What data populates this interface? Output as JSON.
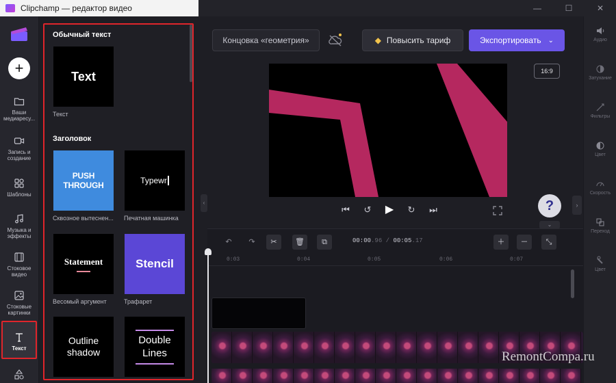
{
  "window": {
    "title": "Clipchamp — редактор видео",
    "controls": [
      "minimize",
      "maximize",
      "close"
    ]
  },
  "rail": {
    "add_label": "+",
    "items": [
      {
        "label": "Ваши медиаресу...",
        "icon": "folder-icon"
      },
      {
        "label": "Запись и создание",
        "icon": "camera-icon"
      },
      {
        "label": "Шаблоны",
        "icon": "templates-icon"
      },
      {
        "label": "Музыка и эффекты",
        "icon": "music-icon"
      },
      {
        "label": "Стоковое видео",
        "icon": "film-icon"
      },
      {
        "label": "Стоковые картинки",
        "icon": "image-icon"
      },
      {
        "label": "Текст",
        "icon": "text-icon",
        "active": true
      }
    ]
  },
  "panel": {
    "section_plain": "Обычный текст",
    "section_heading": "Заголовок",
    "plain_tile": {
      "preview": "Text",
      "caption": "Текст"
    },
    "tiles": [
      {
        "preview": "PUSH THROUGH",
        "caption": "Сквозное вытеснен..."
      },
      {
        "preview": "Typewr",
        "caption": "Печатная машинка"
      },
      {
        "preview": "Statement",
        "caption": "Весомый аргумент"
      },
      {
        "preview": "Stencil",
        "caption": "Трафарет"
      },
      {
        "preview": "Outline shadow",
        "caption": ""
      },
      {
        "preview": "Double Lines",
        "caption": ""
      }
    ]
  },
  "toolbar": {
    "project_name": "Концовка «геометрия»",
    "upgrade_label": "Повысить тариф",
    "export_label": "Экспортировать"
  },
  "preview": {
    "aspect_ratio": "16:9"
  },
  "properties": [
    {
      "label": "Аудио",
      "icon": "volume-icon"
    },
    {
      "label": "Затухание",
      "icon": "fade-icon"
    },
    {
      "label": "Фильтры",
      "icon": "filter-icon"
    },
    {
      "label": "Цвет",
      "icon": "color-icon"
    },
    {
      "label": "Скорость",
      "icon": "speed-icon"
    },
    {
      "label": "Переход",
      "icon": "transition-icon"
    },
    {
      "label": "Цвет",
      "icon": "color2-icon"
    }
  ],
  "help": {
    "label": "?"
  },
  "timeline": {
    "current_time": "00:00",
    "current_time_ms": ".96",
    "total_time": "00:05",
    "total_time_ms": ".17",
    "ticks": [
      "0:03",
      "0:04",
      "0:05",
      "0:06",
      "0:07"
    ]
  },
  "watermark": "RemontCompa.ru",
  "colors": {
    "accent": "#6a55e6",
    "highlight": "#e0252b",
    "preview_shape": "#b5285f",
    "push_through_bg": "#3f8bde",
    "stencil_bg": "#5b47d6"
  }
}
